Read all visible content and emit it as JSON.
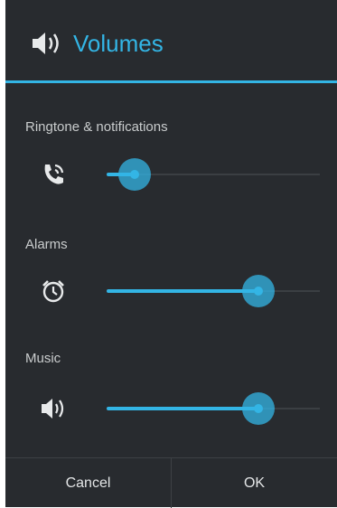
{
  "dialog": {
    "title": "Volumes",
    "title_icon": "speaker-icon",
    "accent_color": "#33b5e5",
    "background_color": "#282b2f"
  },
  "volumes": [
    {
      "label": "Ringtone & notifications",
      "icon": "phone-ring-icon",
      "level": 0.13
    },
    {
      "label": "Alarms",
      "icon": "alarm-clock-icon",
      "level": 0.71
    },
    {
      "label": "Music",
      "icon": "speaker-icon",
      "level": 0.71
    }
  ],
  "buttons": {
    "cancel_label": "Cancel",
    "ok_label": "OK"
  }
}
